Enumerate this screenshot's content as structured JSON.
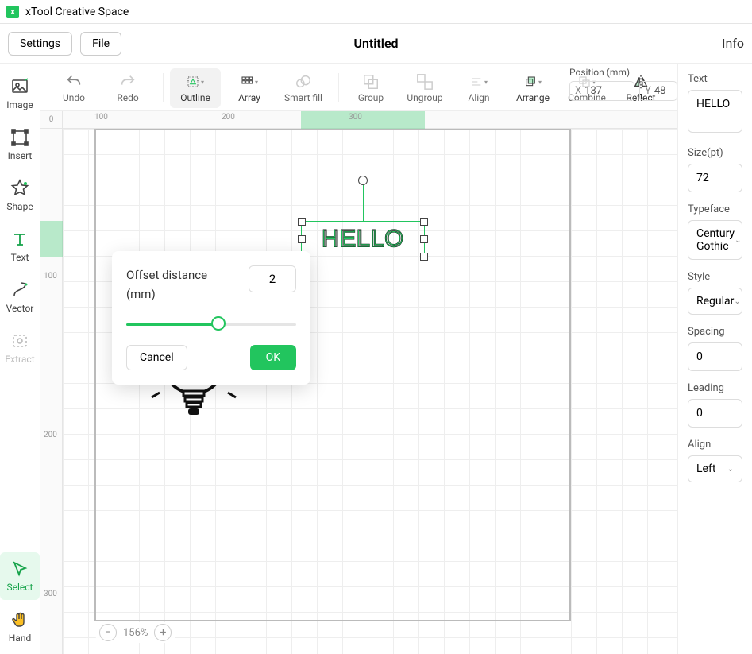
{
  "app": {
    "title": "xTool Creative Space"
  },
  "menu": {
    "settings": "Settings",
    "file": "File",
    "doc_title": "Untitled",
    "info": "Info"
  },
  "rail": {
    "image": "Image",
    "insert": "Insert",
    "shape": "Shape",
    "text": "Text",
    "vector": "Vector",
    "extract": "Extract",
    "select": "Select",
    "hand": "Hand"
  },
  "toolbar": {
    "undo": "Undo",
    "redo": "Redo",
    "outline": "Outline",
    "array": "Array",
    "smart_fill": "Smart fill",
    "group": "Group",
    "ungroup": "Ungroup",
    "align": "Align",
    "arrange": "Arrange",
    "combine": "Combine",
    "reflect": "Reflect"
  },
  "position": {
    "label": "Position (mm)",
    "x_prefix": "X",
    "x_value": "137",
    "y_prefix": "Y",
    "y_value": "48"
  },
  "popover": {
    "label_line1": "Offset distance",
    "label_line2": "(mm)",
    "value": "2",
    "cancel": "Cancel",
    "ok": "OK"
  },
  "canvas": {
    "hello_text": "HELLO",
    "zoom": "156%",
    "ruler_h": [
      "100",
      "200",
      "300"
    ],
    "ruler_v": [
      "100",
      "200",
      "300"
    ],
    "corner": "0"
  },
  "right": {
    "text_label": "Text",
    "text_value": "HELLO",
    "size_label": "Size(pt)",
    "size_value": "72",
    "typeface_label": "Typeface",
    "typeface_value": "Century Gothic",
    "style_label": "Style",
    "style_value": "Regular",
    "spacing_label": "Spacing",
    "spacing_value": "0",
    "leading_label": "Leading",
    "leading_value": "0",
    "align_label": "Align",
    "align_value": "Left"
  }
}
